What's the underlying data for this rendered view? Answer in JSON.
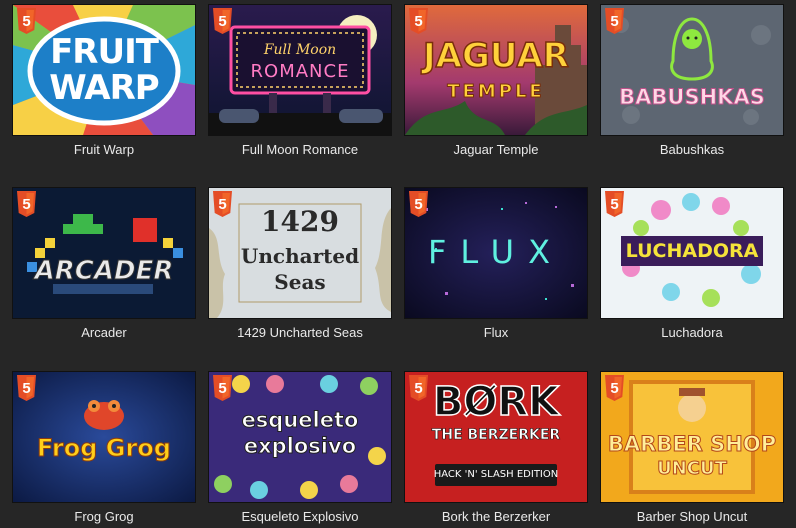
{
  "html5_badge": "5",
  "games": [
    {
      "name": "Fruit Warp",
      "logo": [
        "FRUIT",
        "WARP"
      ]
    },
    {
      "name": "Full Moon Romance",
      "logo": [
        "Full Moon",
        "ROMANCE"
      ]
    },
    {
      "name": "Jaguar Temple",
      "logo": [
        "JAGUAR",
        "TEMPLE"
      ]
    },
    {
      "name": "Babushkas",
      "logo": [
        "BABUSHKAS"
      ]
    },
    {
      "name": "Arcader",
      "logo": [
        "ARCADER"
      ]
    },
    {
      "name": "1429 Uncharted Seas",
      "logo": [
        "1429",
        "Uncharted",
        "Seas"
      ]
    },
    {
      "name": "Flux",
      "logo": [
        "FLUX"
      ]
    },
    {
      "name": "Luchadora",
      "logo": [
        "LUCHADORA"
      ]
    },
    {
      "name": "Frog Grog",
      "logo": [
        "Frog Grog"
      ]
    },
    {
      "name": "Esqueleto Explosivo",
      "logo": [
        "esqueleto",
        "explosivo"
      ]
    },
    {
      "name": "Bork the Berzerker",
      "logo": [
        "BØRK",
        "THE BERZERKER",
        "HACK 'N' SLASH EDITION"
      ]
    },
    {
      "name": "Barber Shop Uncut",
      "logo": [
        "BARBER SHOP",
        "UNCUT"
      ]
    }
  ]
}
